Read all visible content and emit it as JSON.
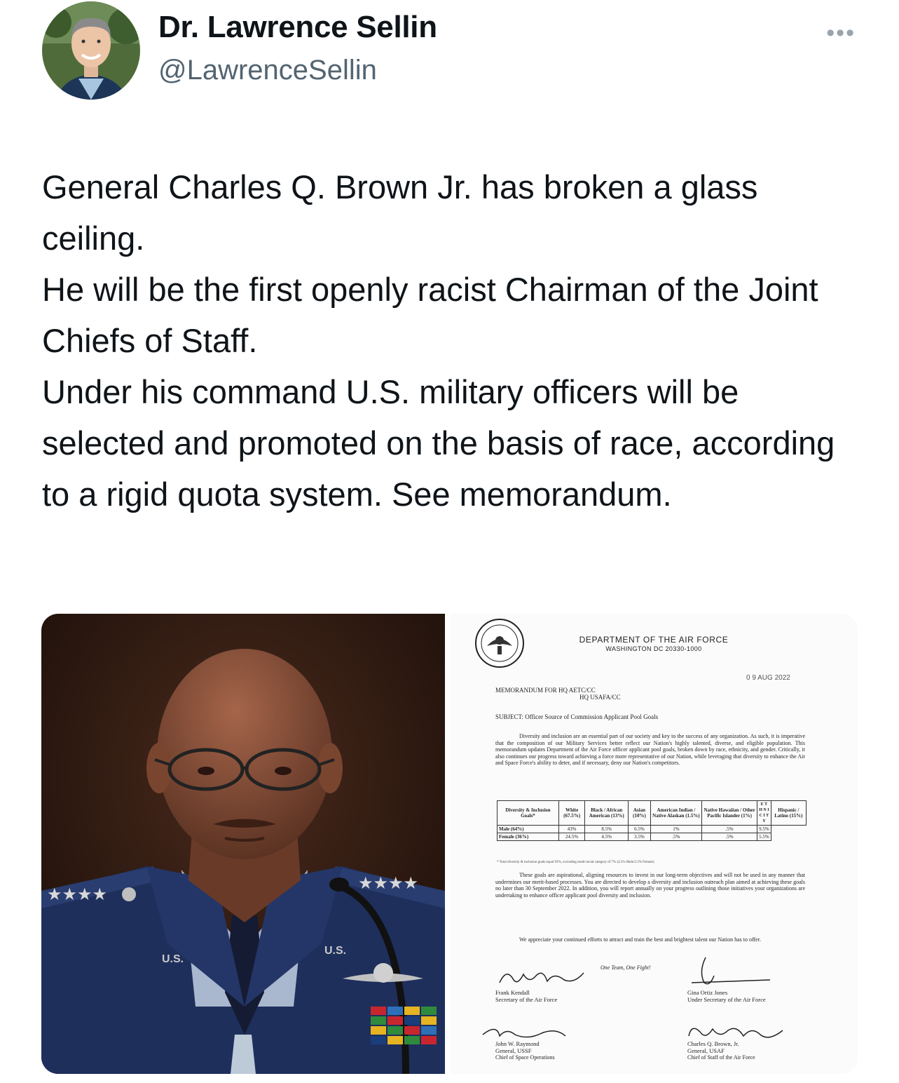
{
  "author": {
    "name": "Dr. Lawrence Sellin",
    "handle": "@LawrenceSellin"
  },
  "more_icon": "ellipsis-icon",
  "tweet": {
    "lines": [
      "General Charles Q. Brown Jr. has broken a glass ceiling.",
      "He will be the first openly racist Chairman of the Joint Chiefs of Staff.",
      "Under his command U.S. military officers will be selected and promoted on the basis of race, according to a rigid quota system. See memorandum."
    ]
  },
  "photo": {
    "patch_left": "U.S.",
    "patch_right": "U.S."
  },
  "memo": {
    "dept": "DEPARTMENT OF THE AIR FORCE",
    "address": "WASHINGTON DC 20330-1000",
    "date": "0 9 AUG 2022",
    "memo_for_1": "MEMORANDUM FOR  HQ AETC/CC",
    "memo_for_2": "HQ USAFA/CC",
    "subject": "SUBJECT:  Officer Source of Commission Applicant Pool Goals",
    "para1": "Diversity and inclusion are an essential part of our society and key to the success of any organization. As such, it is imperative that the composition of our Military Services better reflect our Nation's highly talented, diverse, and eligible population. This memorandum updates Department of the Air Force officer applicant pool goals, broken down by race, ethnicity, and gender. Critically, it also continues our progress toward achieving a force more representative of our Nation, while leveraging that diversity to enhance the Air and Space Force's ability to deter, and if necessary, deny our Nation's competitors.",
    "table": {
      "header": [
        "Diversity & Inclusion Goals*",
        "White (67.5%)",
        "Black / African American (13%)",
        "Asian (10%)",
        "American Indian / Native Alaskan (1.5%)",
        "Native Hawaiian / Other Pacific Islander (1%)",
        "E T H N I C I T Y",
        "Hispanic / Latino (15%)"
      ],
      "rows": [
        [
          "Male (64%)",
          "43%",
          "8.5%",
          "6.5%",
          "1%",
          ".5%",
          "",
          "9.5%"
        ],
        [
          "Female (36%)",
          "24.5%",
          "4.5%",
          "3.5%",
          ".5%",
          ".5%",
          "",
          "5.5%"
        ]
      ],
      "footnote": "* Total diversity & inclusion goals equal 93%, excluding multi-racial category of 7% (4.5% Male/2.5% Female)"
    },
    "para2": "These goals are aspirational, aligning resources to invest in our long-term objectives and will not be used in any manner that undermines our merit-based processes. You are directed to develop a diversity and inclusion outreach plan aimed at achieving these goals no later than 30 September 2022. In addition, you will report annually on your progress outlining those initiatives your organizations are undertaking to enhance officer applicant pool diversity and inclusion.",
    "para3": "We appreciate your continued efforts to attract and train the best and brightest talent our Nation has to offer.",
    "motto": "One Team, One Fight!",
    "signers": [
      {
        "name": "Frank Kendall",
        "title": "Secretary of the Air Force",
        "title2": ""
      },
      {
        "name": "Gina Ortiz Jones",
        "title": "Under Secretary of the Air Force",
        "title2": ""
      },
      {
        "name": "John W. Raymond",
        "title": "General, USSF",
        "title2": "Chief of Space Operations"
      },
      {
        "name": "Charles Q. Brown, Jr.",
        "title": "General, USAF",
        "title2": "Chief of Staff of the Air Force"
      }
    ]
  }
}
